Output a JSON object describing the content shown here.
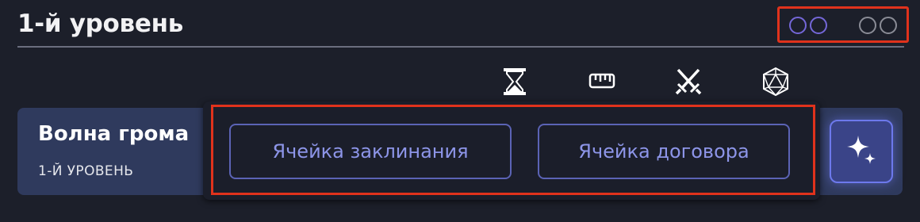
{
  "header": {
    "title": "1-й уровень"
  },
  "slots": {
    "pact": [
      "empty",
      "empty"
    ],
    "spell": [
      "empty",
      "empty"
    ],
    "colors": {
      "pact": "#7467d8",
      "spell": "#8a8c96",
      "highlight": "#e0321c"
    }
  },
  "columns": {
    "icons": [
      "hourglass-icon",
      "ruler-icon",
      "crossed-swords-icon",
      "d20-icon"
    ]
  },
  "spell": {
    "name": "Волна грома",
    "level": "1-Й УРОВЕНЬ"
  },
  "popup": {
    "spell_slot_label": "Ячейка заклинания",
    "pact_slot_label": "Ячейка договора"
  },
  "actions": {
    "magic_icon": "sparkles-icon"
  }
}
